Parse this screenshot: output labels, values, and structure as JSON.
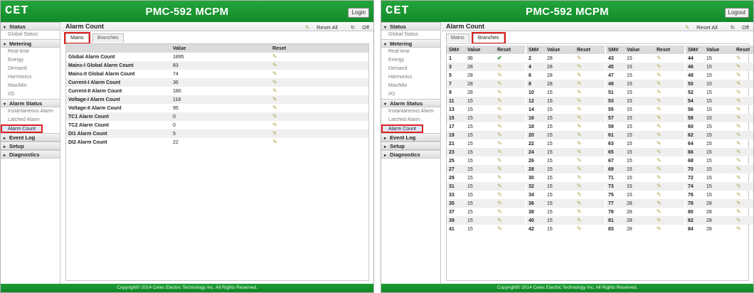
{
  "left": {
    "logo": "CET",
    "title": "PMC-592 MCPM",
    "header_button": "Login",
    "footer": "Copyright© 2014 Ceiec Electric Technology Inc. All Rights Reserved.",
    "page_title": "Alarm Count",
    "reset_all": "Reset All",
    "off": "Off",
    "tabs": [
      "Mains",
      "Branches"
    ],
    "selected_tab": "Mains",
    "columns": [
      "",
      "Value",
      "Reset"
    ],
    "rows": [
      {
        "name": "Global Alarm Count",
        "value": "1895"
      },
      {
        "name": "Mains-I Global Alarm Count",
        "value": "83"
      },
      {
        "name": "Mains-II Global Alarm Count",
        "value": "74"
      },
      {
        "name": "Current-I Alarm Count",
        "value": "36"
      },
      {
        "name": "Current-II Alarm Count",
        "value": "180"
      },
      {
        "name": "Voltage-I Alarm Count",
        "value": "118"
      },
      {
        "name": "Voltage-II Alarm Count",
        "value": "95"
      },
      {
        "name": "TC1 Alarm Count",
        "value": "0"
      },
      {
        "name": "TC2 Alarm Count",
        "value": "0"
      },
      {
        "name": "DI1 Alarm Count",
        "value": "5"
      },
      {
        "name": "DI2 Alarm Count",
        "value": "22"
      }
    ]
  },
  "right": {
    "logo": "CET",
    "title": "PMC-592 MCPM",
    "header_button": "Logout",
    "footer": "Copyright© 2014 Ceiec Electric Technology Inc. All Rights Reserved.",
    "page_title": "Alarm Count",
    "reset_all": "Reset All",
    "off": "Off",
    "tabs": [
      "Mains",
      "Branches"
    ],
    "selected_tab": "Branches",
    "columns": [
      "SM#",
      "Value",
      "Reset"
    ],
    "groups": [
      [
        [
          "1",
          "36"
        ],
        [
          "3",
          "28"
        ],
        [
          "5",
          "28"
        ],
        [
          "7",
          "28"
        ],
        [
          "9",
          "28"
        ],
        [
          "11",
          "15"
        ],
        [
          "13",
          "15"
        ],
        [
          "15",
          "15"
        ],
        [
          "17",
          "15"
        ],
        [
          "19",
          "15"
        ],
        [
          "21",
          "15"
        ],
        [
          "23",
          "15"
        ],
        [
          "25",
          "15"
        ],
        [
          "27",
          "15"
        ],
        [
          "29",
          "15"
        ],
        [
          "31",
          "15"
        ],
        [
          "33",
          "15"
        ],
        [
          "35",
          "15"
        ],
        [
          "37",
          "15"
        ],
        [
          "39",
          "15"
        ],
        [
          "41",
          "15"
        ]
      ],
      [
        [
          "2",
          "28"
        ],
        [
          "4",
          "28"
        ],
        [
          "6",
          "28"
        ],
        [
          "8",
          "28"
        ],
        [
          "10",
          "15"
        ],
        [
          "12",
          "15"
        ],
        [
          "14",
          "15"
        ],
        [
          "16",
          "15"
        ],
        [
          "18",
          "15"
        ],
        [
          "20",
          "15"
        ],
        [
          "22",
          "15"
        ],
        [
          "24",
          "15"
        ],
        [
          "26",
          "15"
        ],
        [
          "28",
          "15"
        ],
        [
          "30",
          "15"
        ],
        [
          "32",
          "15"
        ],
        [
          "34",
          "15"
        ],
        [
          "36",
          "15"
        ],
        [
          "38",
          "15"
        ],
        [
          "40",
          "15"
        ],
        [
          "42",
          "15"
        ]
      ],
      [
        [
          "43",
          "15"
        ],
        [
          "45",
          "15"
        ],
        [
          "47",
          "15"
        ],
        [
          "49",
          "15"
        ],
        [
          "51",
          "15"
        ],
        [
          "53",
          "15"
        ],
        [
          "55",
          "15"
        ],
        [
          "57",
          "15"
        ],
        [
          "59",
          "15"
        ],
        [
          "61",
          "15"
        ],
        [
          "63",
          "15"
        ],
        [
          "65",
          "15"
        ],
        [
          "67",
          "15"
        ],
        [
          "69",
          "15"
        ],
        [
          "71",
          "15"
        ],
        [
          "73",
          "15"
        ],
        [
          "75",
          "15"
        ],
        [
          "77",
          "28"
        ],
        [
          "79",
          "28"
        ],
        [
          "81",
          "28"
        ],
        [
          "83",
          "28"
        ]
      ],
      [
        [
          "44",
          "15"
        ],
        [
          "46",
          "15"
        ],
        [
          "48",
          "15"
        ],
        [
          "50",
          "15"
        ],
        [
          "52",
          "15"
        ],
        [
          "54",
          "15"
        ],
        [
          "56",
          "15"
        ],
        [
          "58",
          "15"
        ],
        [
          "60",
          "15"
        ],
        [
          "62",
          "15"
        ],
        [
          "64",
          "15"
        ],
        [
          "66",
          "15"
        ],
        [
          "68",
          "15"
        ],
        [
          "70",
          "15"
        ],
        [
          "72",
          "15"
        ],
        [
          "74",
          "15"
        ],
        [
          "76",
          "15"
        ],
        [
          "78",
          "28"
        ],
        [
          "80",
          "28"
        ],
        [
          "82",
          "28"
        ],
        [
          "84",
          "28"
        ]
      ]
    ],
    "reset_checked": [
      "1"
    ]
  },
  "sidebar": [
    {
      "label": "Status",
      "expanded": true,
      "items": [
        "Global Status"
      ]
    },
    {
      "label": "Metering",
      "expanded": true,
      "items": [
        "Real-time",
        "Energy",
        "Demand",
        "Harmonics",
        "Max/Min",
        "I/O"
      ]
    },
    {
      "label": "Alarm Status",
      "expanded": true,
      "items": [
        "Instantaneous Alarm",
        "Latched Alarm",
        "Alarm Count"
      ]
    },
    {
      "label": "Event Log",
      "expanded": false,
      "items": []
    },
    {
      "label": "Setup",
      "expanded": false,
      "items": []
    },
    {
      "label": "Diagnostics",
      "expanded": false,
      "items": []
    }
  ],
  "active_item": "Alarm Count",
  "colors": {
    "header_green": "#1a9a34",
    "highlight_red": "#e02020"
  }
}
